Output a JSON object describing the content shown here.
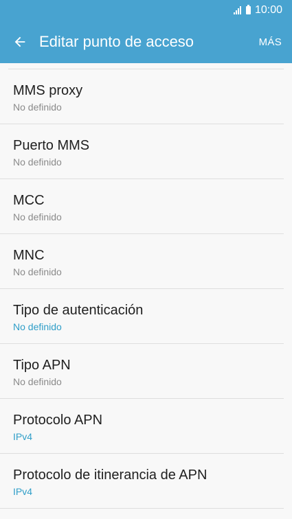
{
  "status_bar": {
    "time": "10:00"
  },
  "app_bar": {
    "title": "Editar punto de acceso",
    "more_label": "MÁS"
  },
  "colors": {
    "accent": "#48a3d0",
    "link": "#2f9ec8"
  },
  "items": [
    {
      "title": "MMS proxy",
      "value": "No definido",
      "accent": false
    },
    {
      "title": "Puerto MMS",
      "value": "No definido",
      "accent": false
    },
    {
      "title": "MCC",
      "value": "No definido",
      "accent": false
    },
    {
      "title": "MNC",
      "value": "No definido",
      "accent": false
    },
    {
      "title": "Tipo de autenticación",
      "value": "No definido",
      "accent": true
    },
    {
      "title": "Tipo APN",
      "value": "No definido",
      "accent": false
    },
    {
      "title": "Protocolo APN",
      "value": "IPv4",
      "accent": true
    },
    {
      "title": "Protocolo de itinerancia de APN",
      "value": "IPv4",
      "accent": true
    }
  ]
}
